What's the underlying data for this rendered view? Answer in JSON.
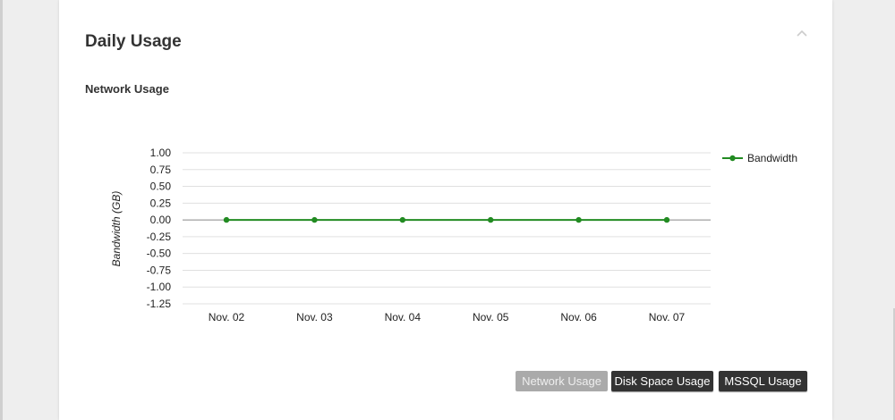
{
  "panel": {
    "title": "Daily Usage",
    "collapse_icon": "chevron-up-icon"
  },
  "section": {
    "title": "Network Usage"
  },
  "chart_data": {
    "type": "line",
    "title": "",
    "xlabel": "",
    "ylabel": "Bandwidth (GB)",
    "categories": [
      "Nov. 02",
      "Nov. 03",
      "Nov. 04",
      "Nov. 05",
      "Nov. 06",
      "Nov. 07"
    ],
    "y_ticks": [
      "1.00",
      "0.75",
      "0.50",
      "0.25",
      "0.00",
      "-0.25",
      "-0.50",
      "-0.75",
      "-1.00",
      "-1.25"
    ],
    "ylim": [
      -1.25,
      1.0
    ],
    "grid": true,
    "legend": "top-right",
    "series": [
      {
        "name": "Bandwidth",
        "values": [
          0,
          0,
          0,
          0,
          0,
          0
        ],
        "color": "#228b22"
      }
    ]
  },
  "buttons": {
    "network_usage": "Network Usage",
    "disk_space_usage": "Disk Space Usage",
    "mssql_usage": "MSSQL Usage"
  },
  "colors": {
    "accent_series": "#228b22",
    "button_dark": "#333333",
    "button_disabled": "#aaaaaa"
  }
}
